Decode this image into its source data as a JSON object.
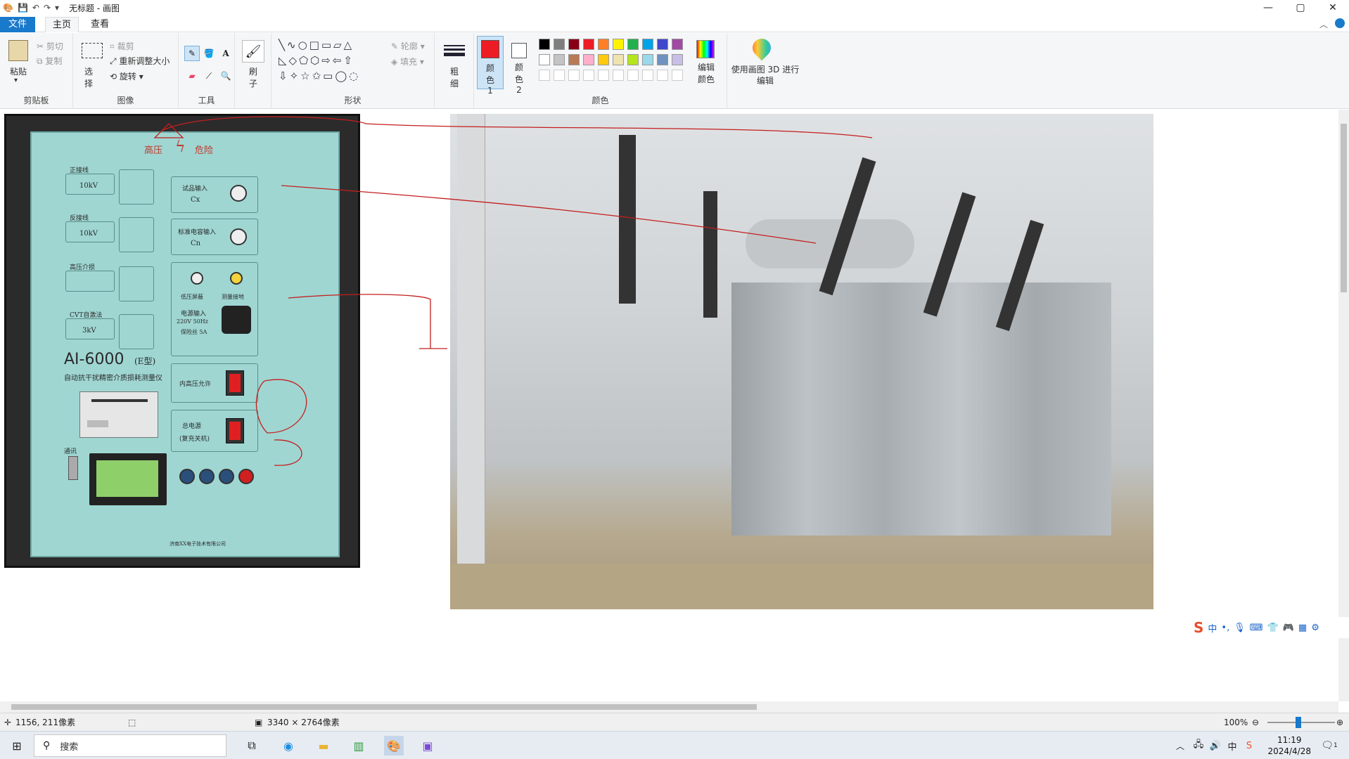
{
  "window": {
    "title": "无标题 - 画图",
    "controls": {
      "minimize": "—",
      "maximize": "▢",
      "close": "✕"
    }
  },
  "menu": {
    "file": "文件",
    "home": "主页",
    "view": "查看"
  },
  "ribbon": {
    "clipboard": {
      "label": "剪贴板",
      "paste": "粘贴",
      "cut": "剪切",
      "copy": "复制"
    },
    "image": {
      "label": "图像",
      "select": "选择",
      "crop": "裁剪",
      "resize": "重新调整大小",
      "rotate": "旋转"
    },
    "tools": {
      "label": "工具"
    },
    "brush": {
      "label": "刷子"
    },
    "shapes": {
      "label": "形状",
      "outline": "轮廓",
      "fill": "填充"
    },
    "size": {
      "label": "粗细"
    },
    "colors": {
      "label": "颜色",
      "color1": "颜色 1",
      "color2": "颜色 2",
      "edit": "编辑颜色",
      "paint3d": "使用画图 3D 进行编辑",
      "color1_value": "#ed1c24",
      "color2_value": "#ffffff",
      "palette_row1": [
        "#000000",
        "#7f7f7f",
        "#880015",
        "#ed1c24",
        "#ff7f27",
        "#fff200",
        "#22b14c",
        "#00a2e8",
        "#3f48cc",
        "#a349a4"
      ],
      "palette_row2": [
        "#ffffff",
        "#c3c3c3",
        "#b97a57",
        "#ffaec9",
        "#ffc90e",
        "#efe4b0",
        "#b5e61d",
        "#99d9ea",
        "#7092be",
        "#c8bfe7"
      ]
    }
  },
  "canvas": {
    "panel": {
      "header_left": "高压",
      "header_right": "危险",
      "model": "AI-6000",
      "model_suffix": "(E型)",
      "subtitle": "自动抗干扰精密介质损耗测量仪",
      "sample_input": "试品输入",
      "sample_cx": "Cx",
      "std_input": "标准电容输入",
      "std_cn": "Cn",
      "hv_shield": "低压屏蔽",
      "meas_ground": "测量接地",
      "power_in": "电源输入",
      "power_spec": "220V  50Hz",
      "fuse": "保险丝 5A",
      "internal_hv": "内高压允许",
      "main_power": "总电源",
      "power_switch": "(复充关机)",
      "diagram1_title": "正接线",
      "diagram1_kv": "10kV",
      "diagram2_title": "反接线",
      "diagram2_kv": "10kV",
      "diagram3_title": "高压介损",
      "diagram4_title": "CVT自激法",
      "diagram4_kv": "3kV",
      "comm": "通讯",
      "maker": "济南XX电子技术有限公司"
    }
  },
  "status": {
    "cursor_pos": "1156, 211像素",
    "image_size": "3340 × 2764像素",
    "zoom": "100%"
  },
  "ime": {
    "lang": "中"
  },
  "taskbar": {
    "search": "搜索",
    "time": "11:19",
    "date": "2024/4/28",
    "notif_count": "1"
  }
}
